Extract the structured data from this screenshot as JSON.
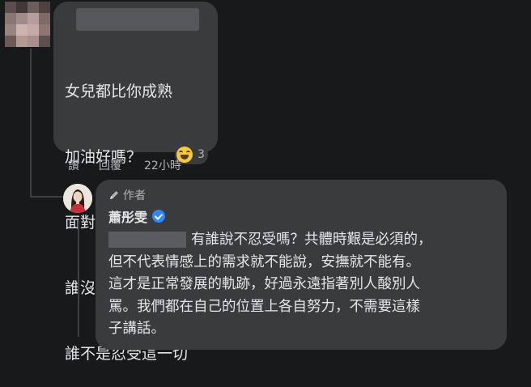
{
  "first_comment": {
    "lines": [
      "女兒都比你成熟",
      "加油好嗎？",
      "面對疫情",
      "誰沒有犧牲",
      "誰不是忍受這一切"
    ],
    "reaction_count": "3",
    "actions": {
      "like": "讚",
      "reply": "回覆",
      "time": "22小時"
    }
  },
  "reply_comment": {
    "author_tag": "作者",
    "author_name": "蕭彤雯",
    "lines": [
      "有誰說不忍受嗎？共體時艱是必須的，",
      "但不代表情感上的需求就不能說，安撫就不能有。",
      "這才是正常發展的軌跡，好過永遠指著別人酸別人",
      "罵。我們都在自己的位置上各自努力，不需要這樣",
      "子講話。"
    ]
  },
  "colors": {
    "background": "#18191a",
    "bubble": "#3a3b3c",
    "text": "#e4e6eb",
    "muted": "#b0b3b8",
    "verified": "#2d88ff"
  }
}
